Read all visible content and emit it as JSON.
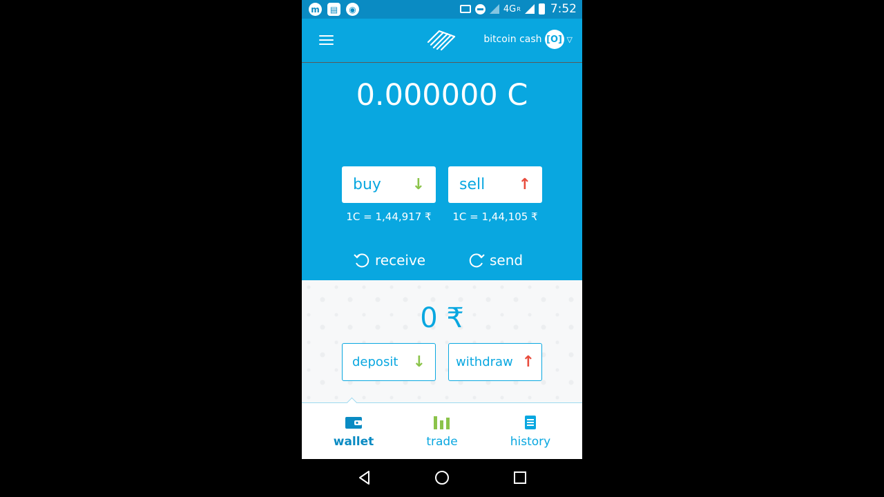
{
  "status_bar": {
    "network": "4G",
    "network_sub": "R",
    "time": "7:52",
    "icons": [
      "app-m-icon",
      "news-icon",
      "vpn-icon",
      "cast-icon",
      "dnd-icon",
      "signal-icon",
      "battery-icon"
    ]
  },
  "header": {
    "currency": "bitcoin cash",
    "currency_badge": "[O]"
  },
  "balance": {
    "crypto": "0.000000 C"
  },
  "trade": {
    "buy_label": "buy",
    "buy_rate": "1C = 1,44,917 ₹",
    "sell_label": "sell",
    "sell_rate": "1C = 1,44,105 ₹",
    "arrow_down": "↓",
    "arrow_up": "↑"
  },
  "actions": {
    "receive_label": "receive",
    "send_label": "send"
  },
  "fiat": {
    "balance": "0 ₹",
    "deposit_label": "deposit",
    "withdraw_label": "withdraw"
  },
  "bottom_nav": {
    "items": [
      {
        "label": "wallet",
        "icon": "wallet-icon",
        "active": true
      },
      {
        "label": "trade",
        "icon": "trade-bars-icon",
        "active": false
      },
      {
        "label": "history",
        "icon": "history-icon",
        "active": false
      }
    ]
  },
  "colors": {
    "primary": "#09a7e0",
    "statusbar": "#0a8bc3",
    "buy_arrow": "#8bc34a",
    "sell_arrow": "#e84c3d",
    "trade_icon": "#8bc34a"
  }
}
